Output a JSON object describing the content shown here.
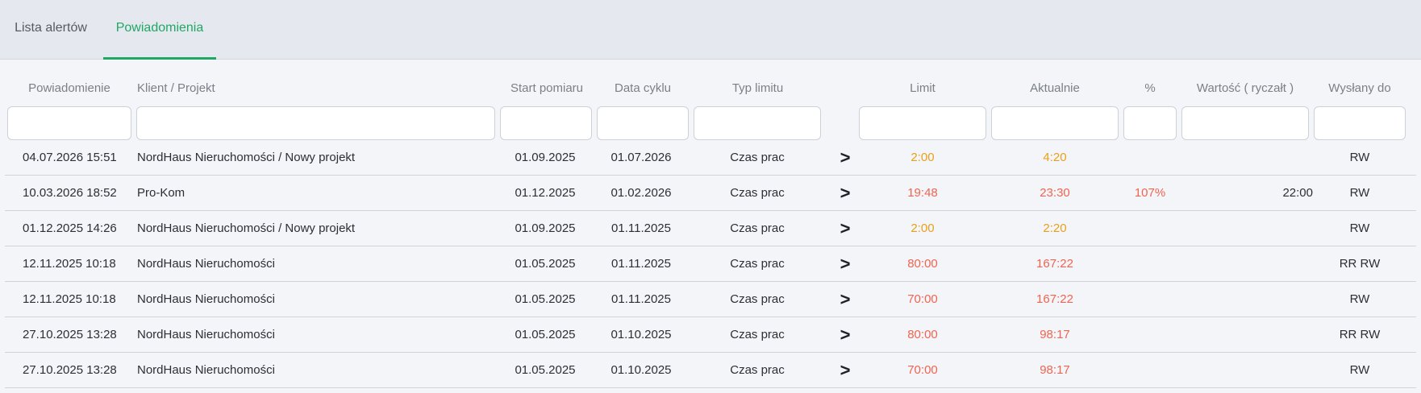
{
  "tabs": [
    {
      "label": "Lista alertów",
      "active": false
    },
    {
      "label": "Powiadomienia",
      "active": true
    }
  ],
  "accent_color": "#1fa864",
  "status_colors": {
    "warning": "#e8a01c",
    "exceeded": "#ee6552"
  },
  "headers": {
    "powiadomienie": "Powiadomienie",
    "klient": "Klient / Projekt",
    "start": "Start pomiaru",
    "cykl": "Data cyklu",
    "typ": "Typ limitu",
    "limit": "Limit",
    "aktualnie": "Aktualnie",
    "procent": "%",
    "wartosc": "Wartość ( ryczałt )",
    "wyslany": "Wysłany do"
  },
  "filters": {
    "powiadomienie": "",
    "klient": "",
    "start": "",
    "cykl": "",
    "typ": "",
    "limit": "",
    "aktualnie": "",
    "procent": "",
    "wartosc": "",
    "wyslany": ""
  },
  "rows": [
    {
      "date": "04.07.2026 15:51",
      "client": "NordHaus Nieruchomości / Nowy projekt",
      "start": "01.09.2025",
      "cycle": "01.07.2026",
      "type": "Czas prac",
      "op": ">",
      "limit": "2:00",
      "current": "4:20",
      "percent": "",
      "value": "",
      "sent": "RW",
      "status": "warning"
    },
    {
      "date": "10.03.2026 18:52",
      "client": "Pro-Kom",
      "start": "01.12.2025",
      "cycle": "01.02.2026",
      "type": "Czas prac",
      "op": ">",
      "limit": "19:48",
      "current": "23:30",
      "percent": "107%",
      "value": "22:00",
      "sent": "RW",
      "status": "exceeded"
    },
    {
      "date": "01.12.2025 14:26",
      "client": "NordHaus Nieruchomości / Nowy projekt",
      "start": "01.09.2025",
      "cycle": "01.11.2025",
      "type": "Czas prac",
      "op": ">",
      "limit": "2:00",
      "current": "2:20",
      "percent": "",
      "value": "",
      "sent": "RW",
      "status": "warning"
    },
    {
      "date": "12.11.2025 10:18",
      "client": "NordHaus Nieruchomości",
      "start": "01.05.2025",
      "cycle": "01.11.2025",
      "type": "Czas prac",
      "op": ">",
      "limit": "80:00",
      "current": "167:22",
      "percent": "",
      "value": "",
      "sent": "RR RW",
      "status": "exceeded"
    },
    {
      "date": "12.11.2025 10:18",
      "client": "NordHaus Nieruchomości",
      "start": "01.05.2025",
      "cycle": "01.11.2025",
      "type": "Czas prac",
      "op": ">",
      "limit": "70:00",
      "current": "167:22",
      "percent": "",
      "value": "",
      "sent": "RW",
      "status": "exceeded"
    },
    {
      "date": "27.10.2025 13:28",
      "client": "NordHaus Nieruchomości",
      "start": "01.05.2025",
      "cycle": "01.10.2025",
      "type": "Czas prac",
      "op": ">",
      "limit": "80:00",
      "current": "98:17",
      "percent": "",
      "value": "",
      "sent": "RR RW",
      "status": "exceeded"
    },
    {
      "date": "27.10.2025 13:28",
      "client": "NordHaus Nieruchomości",
      "start": "01.05.2025",
      "cycle": "01.10.2025",
      "type": "Czas prac",
      "op": ">",
      "limit": "70:00",
      "current": "98:17",
      "percent": "",
      "value": "",
      "sent": "RW",
      "status": "exceeded"
    }
  ]
}
